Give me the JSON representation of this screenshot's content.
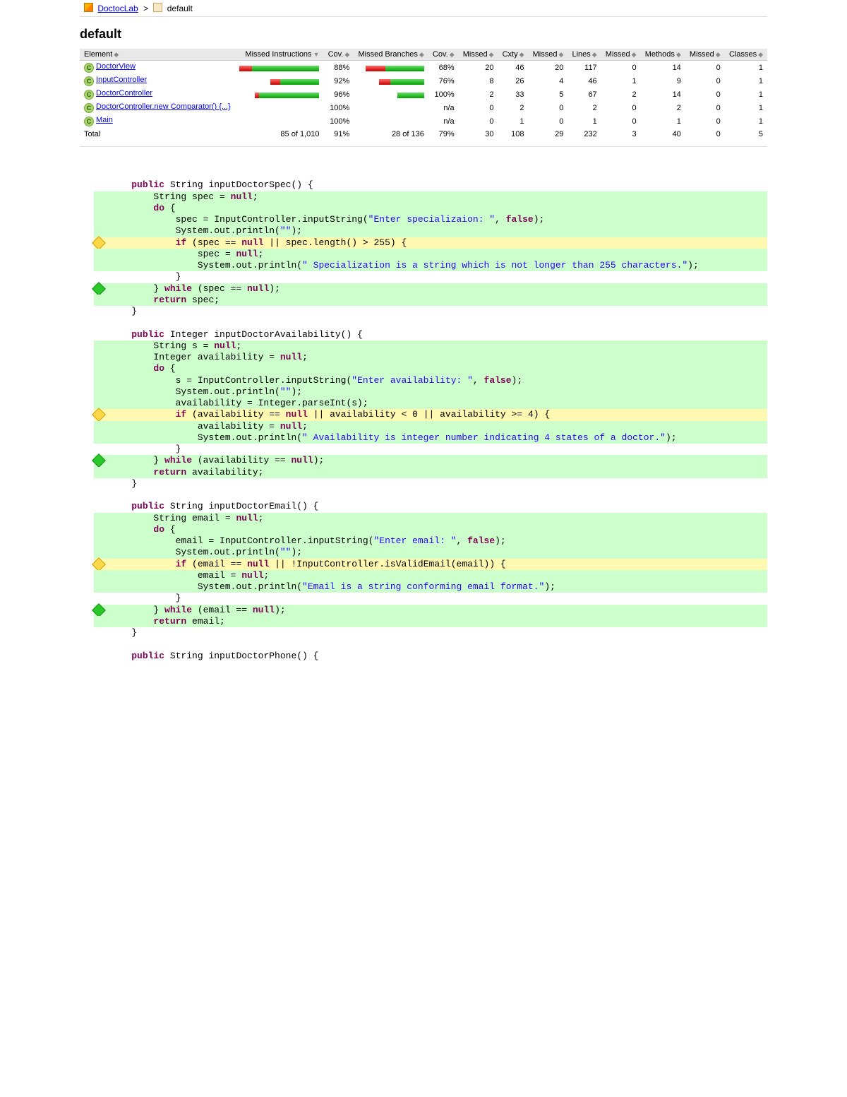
{
  "breadcrumb": {
    "root": "DoctocLab",
    "current": "default"
  },
  "title": "default",
  "table": {
    "headers": {
      "element": "Element",
      "missed_instr": "Missed Instructions",
      "cov1": "Cov.",
      "missed_branches": "Missed Branches",
      "cov2": "Cov.",
      "missed1": "Missed",
      "cxty": "Cxty",
      "missed2": "Missed",
      "lines": "Lines",
      "missed3": "Missed",
      "methods": "Methods",
      "missed4": "Missed",
      "classes": "Classes"
    },
    "rows": [
      {
        "name": "DoctorView",
        "instr_bar": {
          "red": 18,
          "green": 95
        },
        "cov1": "88%",
        "branch_bar": {
          "red": 28,
          "green": 55
        },
        "cov2": "68%",
        "missed1": 20,
        "cxty": 46,
        "missed2": 20,
        "lines": 117,
        "missed3": 0,
        "methods": 14,
        "missed4": 0,
        "classes": 1
      },
      {
        "name": "InputController",
        "instr_bar": {
          "red": 14,
          "green": 55
        },
        "cov1": "92%",
        "branch_bar": {
          "red": 16,
          "green": 48
        },
        "cov2": "76%",
        "missed1": 8,
        "cxty": 26,
        "missed2": 4,
        "lines": 46,
        "missed3": 1,
        "methods": 9,
        "missed4": 0,
        "classes": 1
      },
      {
        "name": "DoctorController",
        "instr_bar": {
          "red": 6,
          "green": 85
        },
        "cov1": "96%",
        "branch_bar": {
          "red": 0,
          "green": 38
        },
        "cov2": "100%",
        "missed1": 2,
        "cxty": 33,
        "missed2": 5,
        "lines": 67,
        "missed3": 2,
        "methods": 14,
        "missed4": 0,
        "classes": 1
      },
      {
        "name": "DoctorController.new Comparator() {...}",
        "instr_bar": {
          "red": 0,
          "green": 0
        },
        "cov1": "100%",
        "branch_bar": {
          "red": 0,
          "green": 0
        },
        "cov2": "n/a",
        "missed1": 0,
        "cxty": 2,
        "missed2": 0,
        "lines": 2,
        "missed3": 0,
        "methods": 2,
        "missed4": 0,
        "classes": 1
      },
      {
        "name": "Main",
        "instr_bar": {
          "red": 0,
          "green": 0
        },
        "cov1": "100%",
        "branch_bar": {
          "red": 0,
          "green": 0
        },
        "cov2": "n/a",
        "missed1": 0,
        "cxty": 1,
        "missed2": 0,
        "lines": 1,
        "missed3": 0,
        "methods": 1,
        "missed4": 0,
        "classes": 1
      }
    ],
    "total": {
      "label": "Total",
      "instr": "85 of 1,010",
      "cov1": "91%",
      "branch": "28 of 136",
      "cov2": "79%",
      "missed1": 30,
      "cxty": 108,
      "missed2": 29,
      "lines": 232,
      "missed3": 3,
      "methods": 40,
      "missed4": 0,
      "classes": 5
    }
  },
  "source": {
    "lines": [
      {
        "cls": "nc",
        "bullet": "",
        "text": ""
      },
      {
        "cls": "nc",
        "bullet": "",
        "text": "    {{kw:public}} String inputDoctorSpec() {"
      },
      {
        "cls": "fc",
        "bullet": "",
        "text": "        String spec = {{kw:null}};"
      },
      {
        "cls": "fc",
        "bullet": "",
        "text": "        {{kw:do}} {"
      },
      {
        "cls": "fc",
        "bullet": "",
        "text": "            spec = InputController.inputString({{str:\"Enter specializaion: \"}}, {{kw:false}});"
      },
      {
        "cls": "fc",
        "bullet": "",
        "text": "            System.out.println({{str:\"\"}});"
      },
      {
        "cls": "pc",
        "bullet": "byellow",
        "text": "            {{kw:if}} (spec == {{kw:null}} || spec.length() > 255) {"
      },
      {
        "cls": "fc",
        "bullet": "",
        "text": "                spec = {{kw:null}};"
      },
      {
        "cls": "fc",
        "bullet": "",
        "text": "                System.out.println({{str:\" Specialization is a string which is not longer than 255 characters.\"}});"
      },
      {
        "cls": "nc",
        "bullet": "",
        "text": "            }"
      },
      {
        "cls": "fc",
        "bullet": "bgreen",
        "text": "        } {{kw:while}} (spec == {{kw:null}});"
      },
      {
        "cls": "fc",
        "bullet": "",
        "text": "        {{kw:return}} spec;"
      },
      {
        "cls": "nc",
        "bullet": "",
        "text": "    }"
      },
      {
        "cls": "nc",
        "bullet": "",
        "text": ""
      },
      {
        "cls": "nc",
        "bullet": "",
        "text": "    {{kw:public}} Integer inputDoctorAvailability() {"
      },
      {
        "cls": "fc",
        "bullet": "",
        "text": "        String s = {{kw:null}};"
      },
      {
        "cls": "fc",
        "bullet": "",
        "text": "        Integer availability = {{kw:null}};"
      },
      {
        "cls": "fc",
        "bullet": "",
        "text": "        {{kw:do}} {"
      },
      {
        "cls": "fc",
        "bullet": "",
        "text": "            s = InputController.inputString({{str:\"Enter availability: \"}}, {{kw:false}});"
      },
      {
        "cls": "fc",
        "bullet": "",
        "text": "            System.out.println({{str:\"\"}});"
      },
      {
        "cls": "fc",
        "bullet": "",
        "text": "            availability = Integer.parseInt(s);"
      },
      {
        "cls": "pc",
        "bullet": "byellow",
        "text": "            {{kw:if}} (availability == {{kw:null}} || availability < 0 || availability >= 4) {"
      },
      {
        "cls": "fc",
        "bullet": "",
        "text": "                availability = {{kw:null}};"
      },
      {
        "cls": "fc",
        "bullet": "",
        "text": "                System.out.println({{str:\" Availability is integer number indicating 4 states of a doctor.\"}});"
      },
      {
        "cls": "nc",
        "bullet": "",
        "text": "            }"
      },
      {
        "cls": "fc",
        "bullet": "bgreen",
        "text": "        } {{kw:while}} (availability == {{kw:null}});"
      },
      {
        "cls": "fc",
        "bullet": "",
        "text": "        {{kw:return}} availability;"
      },
      {
        "cls": "nc",
        "bullet": "",
        "text": "    }"
      },
      {
        "cls": "nc",
        "bullet": "",
        "text": ""
      },
      {
        "cls": "nc",
        "bullet": "",
        "text": "    {{kw:public}} String inputDoctorEmail() {"
      },
      {
        "cls": "fc",
        "bullet": "",
        "text": "        String email = {{kw:null}};"
      },
      {
        "cls": "fc",
        "bullet": "",
        "text": "        {{kw:do}} {"
      },
      {
        "cls": "fc",
        "bullet": "",
        "text": "            email = InputController.inputString({{str:\"Enter email: \"}}, {{kw:false}});"
      },
      {
        "cls": "fc",
        "bullet": "",
        "text": "            System.out.println({{str:\"\"}});"
      },
      {
        "cls": "pc",
        "bullet": "byellow",
        "text": "            {{kw:if}} (email == {{kw:null}} || !InputController.isValidEmail(email)) {"
      },
      {
        "cls": "fc",
        "bullet": "",
        "text": "                email = {{kw:null}};"
      },
      {
        "cls": "fc",
        "bullet": "",
        "text": "                System.out.println({{str:\"Email is a string conforming email format.\"}});"
      },
      {
        "cls": "nc",
        "bullet": "",
        "text": "            }"
      },
      {
        "cls": "fc",
        "bullet": "bgreen",
        "text": "        } {{kw:while}} (email == {{kw:null}});"
      },
      {
        "cls": "fc",
        "bullet": "",
        "text": "        {{kw:return}} email;"
      },
      {
        "cls": "nc",
        "bullet": "",
        "text": "    }"
      },
      {
        "cls": "nc",
        "bullet": "",
        "text": ""
      },
      {
        "cls": "nc",
        "bullet": "",
        "text": "    {{kw:public}} String inputDoctorPhone() {"
      }
    ]
  }
}
